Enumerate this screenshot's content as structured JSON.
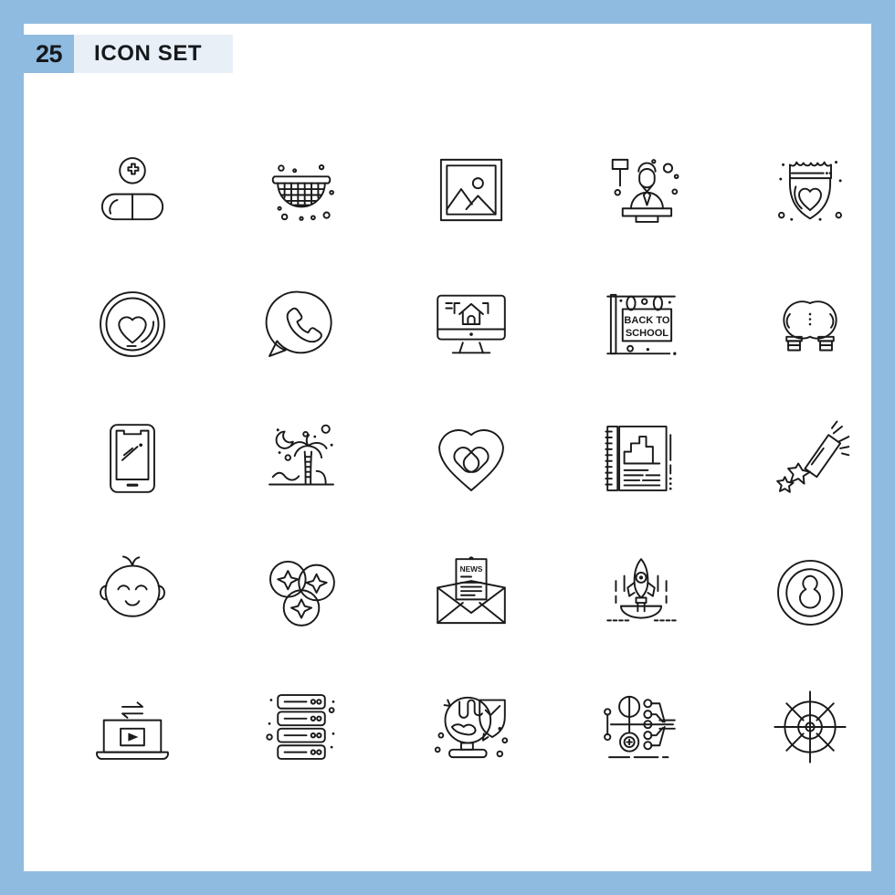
{
  "header": {
    "count": "25",
    "title": "ICON SET",
    "badge_color": "#8fbbe0",
    "title_bg_color": "#e8eff7",
    "border_color": "#8fbbe0",
    "sheet_color": "#ffffff",
    "stroke_color": "#1a1a1a"
  },
  "grid": {
    "columns": 5,
    "rows": 5,
    "total_icons": 25
  },
  "icons": [
    {
      "index": 1,
      "name": "pill-medical-plus-icon",
      "label": "Pill"
    },
    {
      "index": 2,
      "name": "strainer-colander-icon",
      "label": "Strainer"
    },
    {
      "index": 3,
      "name": "picture-frame-gallery-icon",
      "label": "Picture"
    },
    {
      "index": 4,
      "name": "judge-gavel-icon",
      "label": "Judge"
    },
    {
      "index": 5,
      "name": "police-badge-heart-icon",
      "label": "Badge"
    },
    {
      "index": 6,
      "name": "heart-circle-coin-icon",
      "label": "Love"
    },
    {
      "index": 7,
      "name": "whatsapp-phone-chat-icon",
      "label": "Whatsapp"
    },
    {
      "index": 8,
      "name": "monitor-house-online-icon",
      "label": "Real Estate"
    },
    {
      "index": 9,
      "name": "back-to-school-sign-icon",
      "label": "Back To School"
    },
    {
      "index": 10,
      "name": "double-light-bulb-icon",
      "label": "Bulbs"
    },
    {
      "index": 11,
      "name": "smartphone-mobile-icon",
      "label": "Smartphone"
    },
    {
      "index": 12,
      "name": "palm-tree-night-beach-icon",
      "label": "Beach"
    },
    {
      "index": 13,
      "name": "heart-bandage-healing-icon",
      "label": "Healing"
    },
    {
      "index": 14,
      "name": "notebook-report-chart-icon",
      "label": "Report"
    },
    {
      "index": 15,
      "name": "shooting-star-comet-icon",
      "label": "Comet"
    },
    {
      "index": 16,
      "name": "baby-face-icon",
      "label": "Baby"
    },
    {
      "index": 17,
      "name": "blueberries-fruit-icon",
      "label": "Blueberry"
    },
    {
      "index": 18,
      "name": "newsletter-envelope-icon",
      "label": "Newsletter"
    },
    {
      "index": 19,
      "name": "rocket-launch-bowl-icon",
      "label": "Launch"
    },
    {
      "index": 20,
      "name": "keyhole-lock-circle-icon",
      "label": "Keyhole"
    },
    {
      "index": 21,
      "name": "laptop-video-streaming-icon",
      "label": "Streaming"
    },
    {
      "index": 22,
      "name": "server-stack-icon",
      "label": "Server"
    },
    {
      "index": 23,
      "name": "globe-shield-security-icon",
      "label": "Global Security"
    },
    {
      "index": 24,
      "name": "network-nodes-diagram-icon",
      "label": "Network"
    },
    {
      "index": 25,
      "name": "target-crosshair-icon",
      "label": "Target"
    }
  ],
  "icon_text": {
    "back_to_school_line1": "BACK TO",
    "back_to_school_line2": "SCHOOL",
    "news_label": "NEWS"
  }
}
